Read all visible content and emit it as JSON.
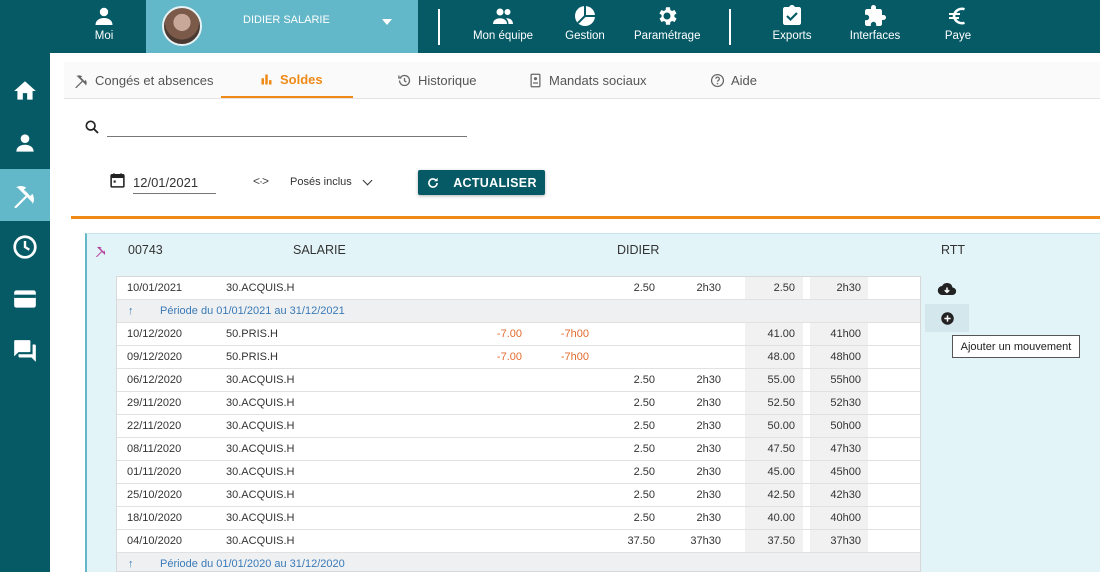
{
  "topbar": {
    "moi": "Moi",
    "user_name": "DIDIER SALARIE",
    "items": [
      "Mon équipe",
      "Gestion",
      "Paramétrage",
      "Exports",
      "Interfaces",
      "Paye"
    ]
  },
  "sidebar": {
    "items": [
      "home-icon",
      "person-icon",
      "beach-umbrella-icon",
      "clock-icon",
      "card-icon",
      "chat-icon"
    ],
    "active_index": 2
  },
  "tabs": [
    {
      "label": "Congés et absences",
      "icon": "umbrella-icon"
    },
    {
      "label": "Soldes",
      "icon": "bar-chart-icon",
      "active": true
    },
    {
      "label": "Historique",
      "icon": "history-icon"
    },
    {
      "label": "Mandats sociaux",
      "icon": "badge-icon"
    },
    {
      "label": "Aide",
      "icon": "help-icon"
    }
  ],
  "filters": {
    "search_value": "",
    "date": "12/01/2021",
    "select_value": "Posés inclus",
    "refresh_label": "ACTUALISER"
  },
  "employee": {
    "id": "00743",
    "last_name": "SALARIE",
    "first_name": "DIDIER",
    "counter": "RTT"
  },
  "rows": [
    {
      "type": "data",
      "date": "10/01/2021",
      "code": "30.ACQUIS.H",
      "neg_dec": "",
      "neg_hm": "",
      "pos_dec": "2.50",
      "pos_hm": "2h30",
      "bal_dec": "2.50",
      "bal_hm": "2h30"
    },
    {
      "type": "period",
      "label": "Période du 01/01/2021 au 31/12/2021"
    },
    {
      "type": "data",
      "date": "10/12/2020",
      "code": "50.PRIS.H",
      "neg_dec": "-7.00",
      "neg_hm": "-7h00",
      "pos_dec": "",
      "pos_hm": "",
      "bal_dec": "41.00",
      "bal_hm": "41h00"
    },
    {
      "type": "data",
      "date": "09/12/2020",
      "code": "50.PRIS.H",
      "neg_dec": "-7.00",
      "neg_hm": "-7h00",
      "pos_dec": "",
      "pos_hm": "",
      "bal_dec": "48.00",
      "bal_hm": "48h00"
    },
    {
      "type": "data",
      "date": "06/12/2020",
      "code": "30.ACQUIS.H",
      "neg_dec": "",
      "neg_hm": "",
      "pos_dec": "2.50",
      "pos_hm": "2h30",
      "bal_dec": "55.00",
      "bal_hm": "55h00"
    },
    {
      "type": "data",
      "date": "29/11/2020",
      "code": "30.ACQUIS.H",
      "neg_dec": "",
      "neg_hm": "",
      "pos_dec": "2.50",
      "pos_hm": "2h30",
      "bal_dec": "52.50",
      "bal_hm": "52h30"
    },
    {
      "type": "data",
      "date": "22/11/2020",
      "code": "30.ACQUIS.H",
      "neg_dec": "",
      "neg_hm": "",
      "pos_dec": "2.50",
      "pos_hm": "2h30",
      "bal_dec": "50.00",
      "bal_hm": "50h00"
    },
    {
      "type": "data",
      "date": "08/11/2020",
      "code": "30.ACQUIS.H",
      "neg_dec": "",
      "neg_hm": "",
      "pos_dec": "2.50",
      "pos_hm": "2h30",
      "bal_dec": "47.50",
      "bal_hm": "47h30"
    },
    {
      "type": "data",
      "date": "01/11/2020",
      "code": "30.ACQUIS.H",
      "neg_dec": "",
      "neg_hm": "",
      "pos_dec": "2.50",
      "pos_hm": "2h30",
      "bal_dec": "45.00",
      "bal_hm": "45h00"
    },
    {
      "type": "data",
      "date": "25/10/2020",
      "code": "30.ACQUIS.H",
      "neg_dec": "",
      "neg_hm": "",
      "pos_dec": "2.50",
      "pos_hm": "2h30",
      "bal_dec": "42.50",
      "bal_hm": "42h30"
    },
    {
      "type": "data",
      "date": "18/10/2020",
      "code": "30.ACQUIS.H",
      "neg_dec": "",
      "neg_hm": "",
      "pos_dec": "2.50",
      "pos_hm": "2h30",
      "bal_dec": "40.00",
      "bal_hm": "40h00"
    },
    {
      "type": "data",
      "date": "04/10/2020",
      "code": "30.ACQUIS.H",
      "neg_dec": "",
      "neg_hm": "",
      "pos_dec": "37.50",
      "pos_hm": "37h30",
      "bal_dec": "37.50",
      "bal_hm": "37h30"
    },
    {
      "type": "period",
      "label": "Période du 01/01/2020 au 31/12/2020"
    }
  ],
  "actions": {
    "tooltip": "Ajouter un mouvement"
  },
  "colors": {
    "primary": "#055a66",
    "accent_light": "#62b7c8",
    "orange": "#ef8a17",
    "negative": "#e26a2c",
    "period_text": "#3a7ab8",
    "panel_bg": "#e2f4f8"
  }
}
